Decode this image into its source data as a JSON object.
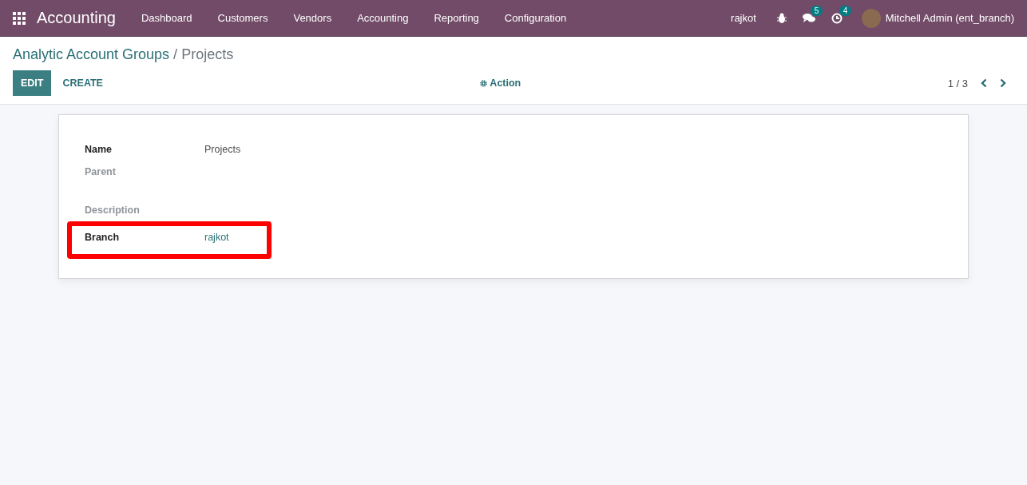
{
  "navbar": {
    "app_title": "Accounting",
    "menu": [
      "Dashboard",
      "Customers",
      "Vendors",
      "Accounting",
      "Reporting",
      "Configuration"
    ],
    "branch": "rajkot",
    "messages_count": "5",
    "activities_count": "4",
    "user": "Mitchell Admin (ent_branch)"
  },
  "breadcrumb": {
    "parent": "Analytic Account Groups",
    "separator": "/",
    "current": "Projects"
  },
  "buttons": [
    {
      "label": "EDIT",
      "kind": "primary"
    },
    {
      "label": "CREATE",
      "kind": "secondary"
    }
  ],
  "action": {
    "label": "Action"
  },
  "pager": {
    "value": "1 / 3"
  },
  "form": {
    "fields": [
      {
        "label": "Name",
        "value": "Projects",
        "required": true,
        "kind": "text",
        "highlighted": false
      },
      {
        "label": "Parent",
        "required": false,
        "highlighted": false
      },
      {
        "label": "Description",
        "required": false,
        "highlighted": false
      },
      {
        "label": "Branch",
        "value": "rajkot",
        "required": true,
        "kind": "link",
        "highlighted": true
      }
    ]
  }
}
